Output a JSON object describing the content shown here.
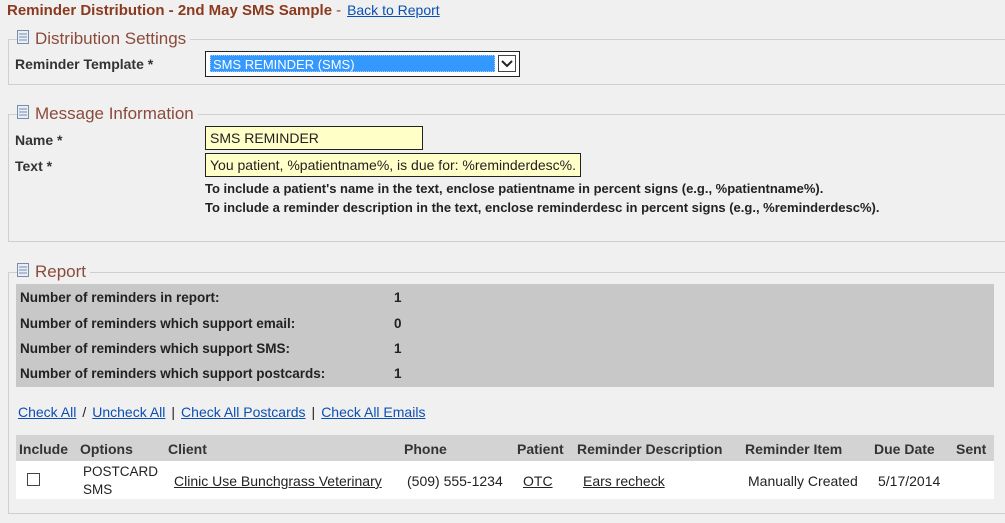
{
  "header": {
    "title": "Reminder Distribution - 2nd May SMS Sample",
    "separator": "-",
    "back_link": "Back to Report"
  },
  "distribution": {
    "legend": "Distribution Settings",
    "template_label": "Reminder Template *",
    "template_value": "SMS REMINDER (SMS)"
  },
  "message": {
    "legend": "Message Information",
    "name_label": "Name *",
    "name_value": "SMS REMINDER",
    "text_label": "Text *",
    "text_value": "You patient, %patientname%, is due for: %reminderdesc%.",
    "help1": "To include a patient's name in the text, enclose patientname in percent signs (e.g., %patientname%).",
    "help2": "To include a reminder description in the text, enclose reminderdesc in percent signs (e.g., %reminderdesc%)."
  },
  "report": {
    "legend": "Report",
    "stats": [
      {
        "label": "Number of reminders in report:",
        "value": "1"
      },
      {
        "label": "Number of reminders which support email:",
        "value": "0"
      },
      {
        "label": "Number of reminders which support SMS:",
        "value": "1"
      },
      {
        "label": "Number of reminders which support postcards:",
        "value": "1"
      }
    ],
    "links": {
      "check_all": "Check All",
      "sep1": "/",
      "uncheck_all": "Uncheck All",
      "sep2": "|",
      "check_postcards": "Check All Postcards",
      "sep3": "|",
      "check_emails": "Check All Emails"
    },
    "columns": [
      "Include",
      "Options",
      "Client",
      "Phone",
      "Patient",
      "Reminder Description",
      "Reminder Item",
      "Due Date",
      "Sent"
    ],
    "rows": [
      {
        "options_1": "POSTCARD",
        "options_2": "SMS",
        "client": "Clinic Use Bunchgrass Veterinary",
        "phone": "(509) 555-1234",
        "patient": "OTC",
        "reminder_description": "Ears recheck",
        "reminder_item": "Manually Created",
        "due_date": "5/17/2014",
        "sent": ""
      }
    ]
  },
  "colors": {
    "title": "#8b3a1f",
    "link": "#0b4fb3",
    "input_bg": "#ffffc8",
    "select_highlight": "#3399ff",
    "stats_bg": "#c8c8c8"
  }
}
